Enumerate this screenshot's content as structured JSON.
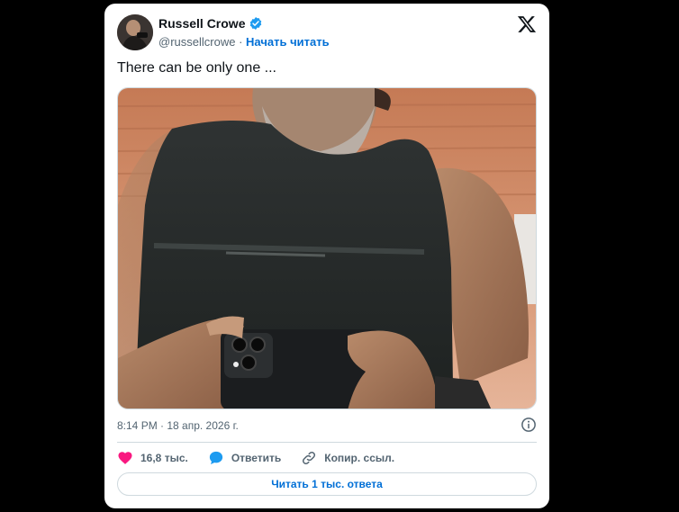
{
  "author": {
    "name": "Russell Crowe",
    "handle": "@russellcrowe",
    "separator": "·",
    "follow_label": "Начать читать"
  },
  "tweet": {
    "text": "There can be only one ...",
    "timestamp": "8:14 PM · 18 апр. 2026 г."
  },
  "actions": {
    "likes": "16,8 тыс.",
    "reply_label": "Ответить",
    "copy_link_label": "Копир. ссыл."
  },
  "read_replies_label": "Читать 1 тыс. ответа",
  "colors": {
    "accent": "#006fd6",
    "like_red": "#f91880",
    "reply_blue": "#1d9bf0",
    "verified_blue": "#1d9bf0",
    "text": "#0f1419",
    "muted": "#536471"
  },
  "icons": [
    "verified-badge-icon",
    "x-logo-icon",
    "info-icon",
    "heart-icon",
    "reply-bubble-icon",
    "link-icon"
  ]
}
